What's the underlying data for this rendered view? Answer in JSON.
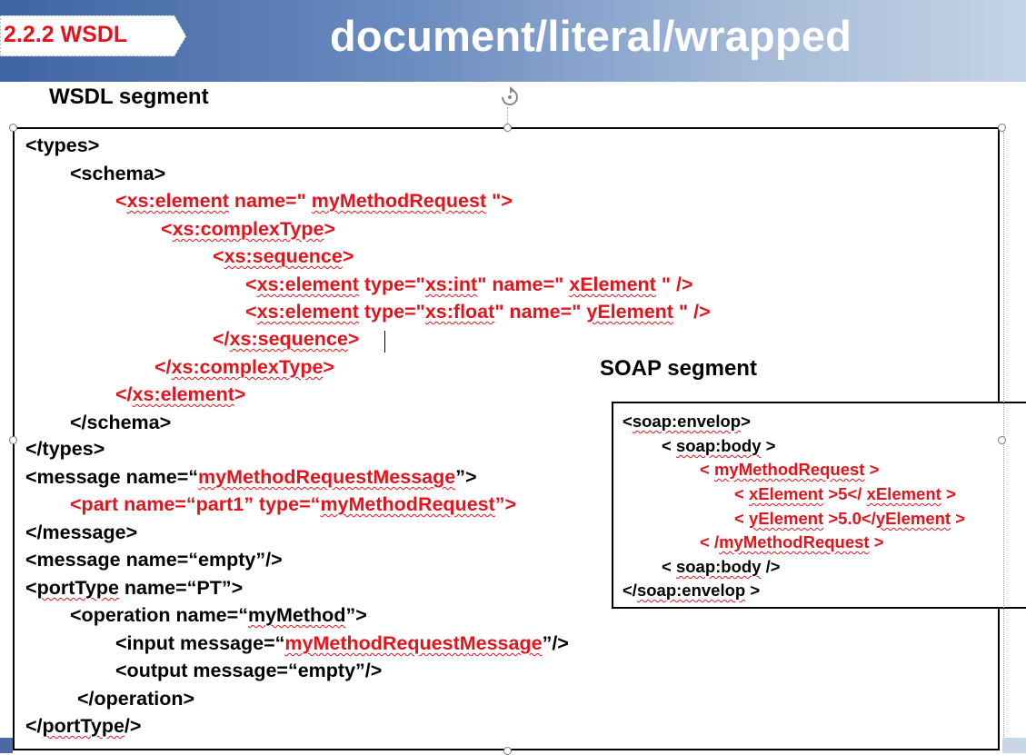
{
  "header": {
    "section_badge": "2.2.2 WSDL",
    "title": "document/literal/wrapped"
  },
  "labels": {
    "wsdl_segment": "WSDL segment",
    "soap_segment": "SOAP segment"
  },
  "wsdl_code": [
    [
      {
        "t": "<types>"
      }
    ],
    [
      {
        "t": "<schema>"
      }
    ],
    [
      {
        "t": "<",
        "c": "red"
      },
      {
        "t": "xs:element",
        "c": "red",
        "u": true
      },
      {
        "t": " name=\" ",
        "c": "red"
      },
      {
        "t": "myMethodRequest",
        "c": "red",
        "u": true
      },
      {
        "t": " \">",
        "c": "red"
      }
    ],
    [
      {
        "t": "<",
        "c": "red"
      },
      {
        "t": "xs:complexType",
        "c": "red",
        "u": true
      },
      {
        "t": ">",
        "c": "red"
      }
    ],
    [
      {
        "t": "<",
        "c": "red"
      },
      {
        "t": "xs:sequence",
        "c": "red",
        "u": true
      },
      {
        "t": ">",
        "c": "red"
      }
    ],
    [
      {
        "t": "<",
        "c": "red"
      },
      {
        "t": "xs:element",
        "c": "red",
        "u": true
      },
      {
        "t": " type=\"",
        "c": "red"
      },
      {
        "t": "xs:int",
        "c": "red",
        "u": true
      },
      {
        "t": "\" name=\" ",
        "c": "red"
      },
      {
        "t": "xElement",
        "c": "red",
        "u": true
      },
      {
        "t": " \" />",
        "c": "red"
      }
    ],
    [
      {
        "t": "<",
        "c": "red"
      },
      {
        "t": "xs:element",
        "c": "red",
        "u": true
      },
      {
        "t": " type=\"",
        "c": "red"
      },
      {
        "t": "xs:float",
        "c": "red",
        "u": true
      },
      {
        "t": "\" name=\" ",
        "c": "red"
      },
      {
        "t": "yElement",
        "c": "red",
        "u": true
      },
      {
        "t": " \" />",
        "c": "red"
      }
    ],
    [
      {
        "t": "</",
        "c": "red"
      },
      {
        "t": "xs:sequence",
        "c": "red",
        "u": true
      },
      {
        "t": ">",
        "c": "red"
      }
    ],
    [
      {
        "t": "</",
        "c": "red"
      },
      {
        "t": "xs:complexType",
        "c": "red",
        "u": true
      },
      {
        "t": ">",
        "c": "red"
      }
    ],
    [
      {
        "t": "</",
        "c": "red"
      },
      {
        "t": "xs:element",
        "c": "red",
        "u": true
      },
      {
        "t": ">",
        "c": "red"
      }
    ],
    [
      {
        "t": "</schema>"
      }
    ],
    [
      {
        "t": "</types>"
      }
    ],
    [
      {
        "t": "<message name=“"
      },
      {
        "t": "myMethodRequestMessage",
        "c": "red",
        "u": true
      },
      {
        "t": "”>"
      }
    ],
    [
      {
        "t": "<part name=“part1” type=“",
        "c": "red"
      },
      {
        "t": "myMethodRequest",
        "c": "red",
        "u": true
      },
      {
        "t": "”>",
        "c": "red"
      }
    ],
    [
      {
        "t": "</message>"
      }
    ],
    [
      {
        "t": "<message name=“empty”/>"
      }
    ],
    [
      {
        "t": "<"
      },
      {
        "t": "portType",
        "u": true
      },
      {
        "t": " name=“PT”>"
      }
    ],
    [
      {
        "t": "<operation name=“"
      },
      {
        "t": "myMethod",
        "u": true
      },
      {
        "t": "”>"
      }
    ],
    [
      {
        "t": "<input message=“"
      },
      {
        "t": "myMethodRequestMessage",
        "c": "red",
        "u": true
      },
      {
        "t": "”/>"
      }
    ],
    [
      {
        "t": "<output message=“empty”/>"
      }
    ],
    [
      {
        "t": "</operation>"
      }
    ],
    [
      {
        "t": "</"
      },
      {
        "t": "portType",
        "u": true
      },
      {
        "t": "/>"
      }
    ]
  ],
  "soap_code": [
    [
      {
        "t": "<"
      },
      {
        "t": "soap:envelop",
        "u": true
      },
      {
        "t": ">"
      }
    ],
    [
      {
        "t": "< "
      },
      {
        "t": "soap:body",
        "u": true
      },
      {
        "t": " >"
      }
    ],
    [
      {
        "t": "< ",
        "c": "red"
      },
      {
        "t": "myMethodRequest",
        "c": "red",
        "u": true
      },
      {
        "t": " >",
        "c": "red"
      }
    ],
    [
      {
        "t": "< ",
        "c": "red"
      },
      {
        "t": "xElement",
        "c": "red",
        "u": true
      },
      {
        "t": " >5</ ",
        "c": "red"
      },
      {
        "t": "xElement",
        "c": "red",
        "u": true
      },
      {
        "t": " >",
        "c": "red"
      }
    ],
    [
      {
        "t": "< ",
        "c": "red"
      },
      {
        "t": "yElement",
        "c": "red",
        "u": true
      },
      {
        "t": " >5.0</",
        "c": "red"
      },
      {
        "t": "yElement",
        "c": "red",
        "u": true
      },
      {
        "t": " >",
        "c": "red"
      }
    ],
    [
      {
        "t": "< /",
        "c": "red"
      },
      {
        "t": "myMethodRequest",
        "c": "red",
        "u": true
      },
      {
        "t": " >",
        "c": "red"
      }
    ],
    [
      {
        "t": "< "
      },
      {
        "t": "soap:body",
        "u": true
      },
      {
        "t": " />"
      }
    ],
    [
      {
        "t": "</"
      },
      {
        "t": "soap:envelop",
        "u": true
      },
      {
        "t": " >"
      }
    ]
  ],
  "colors": {
    "accent_red": "#e3141b",
    "header_blue": "#3f64a2"
  },
  "icons": {
    "rotate_handle": "rotate-handle-icon"
  }
}
